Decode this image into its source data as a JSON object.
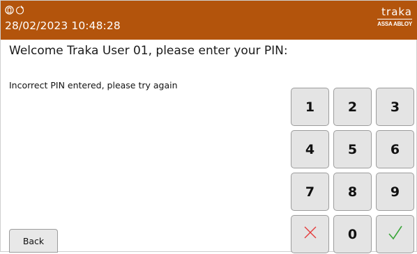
{
  "header": {
    "datetime": "28/02/2023 10:48:28",
    "brand_name": "traka",
    "brand_sub": "ASSA ABLOY",
    "status_icons": [
      "battery-icon",
      "power-plug-icon"
    ],
    "background": "#b3540c"
  },
  "prompt": "Welcome Traka User 01, please enter your PIN:",
  "message": "Incorrect PIN entered, please try again",
  "keypad": {
    "digits": [
      "1",
      "2",
      "3",
      "4",
      "5",
      "6",
      "7",
      "8",
      "9",
      "0"
    ],
    "clear_icon": "cross-icon",
    "confirm_icon": "check-icon",
    "clear_color": "#e53b3b",
    "confirm_color": "#3aa63a"
  },
  "back_label": "Back"
}
